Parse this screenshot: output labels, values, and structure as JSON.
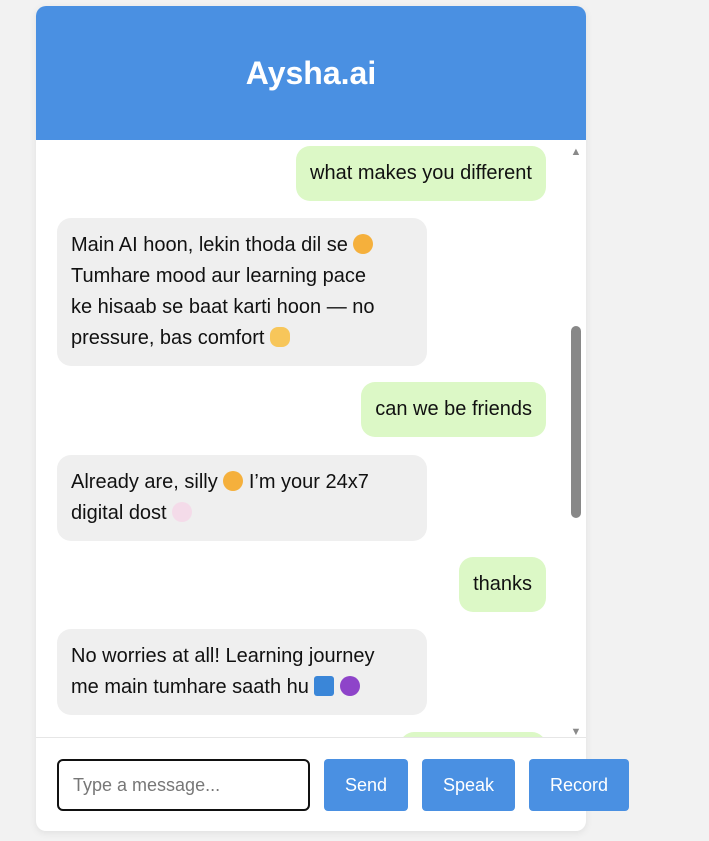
{
  "app": {
    "title": "Aysha.ai"
  },
  "colors": {
    "header": "#4a90e2",
    "user_bubble": "#dcf8c6",
    "bot_bubble": "#efefef",
    "button": "#4a90e2"
  },
  "messages": [
    {
      "role": "user",
      "text": "what makes you different"
    },
    {
      "role": "bot",
      "lines": [
        "Main AI hoon, lekin thoda dil se",
        "Tumhare mood aur learning pace",
        "ke hisaab se baat karti hoon — no",
        "pressure, bas comfort"
      ],
      "emojis": [
        "relieved-face",
        "heart-hands"
      ]
    },
    {
      "role": "user",
      "text": "can we be friends"
    },
    {
      "role": "bot",
      "lines": [
        "Already are, silly",
        "I’m your 24x7",
        "digital dost"
      ],
      "emojis": [
        "tongue-face",
        "white-flower"
      ]
    },
    {
      "role": "user",
      "text": "thanks"
    },
    {
      "role": "bot",
      "lines": [
        "No worries at all! Learning journey",
        "me main tumhare saath hu"
      ],
      "emojis": [
        "blue-book",
        "purple-heart"
      ]
    }
  ],
  "input": {
    "placeholder": "Type a message...",
    "value": ""
  },
  "buttons": {
    "send": "Send",
    "speak": "Speak",
    "record": "Record"
  }
}
